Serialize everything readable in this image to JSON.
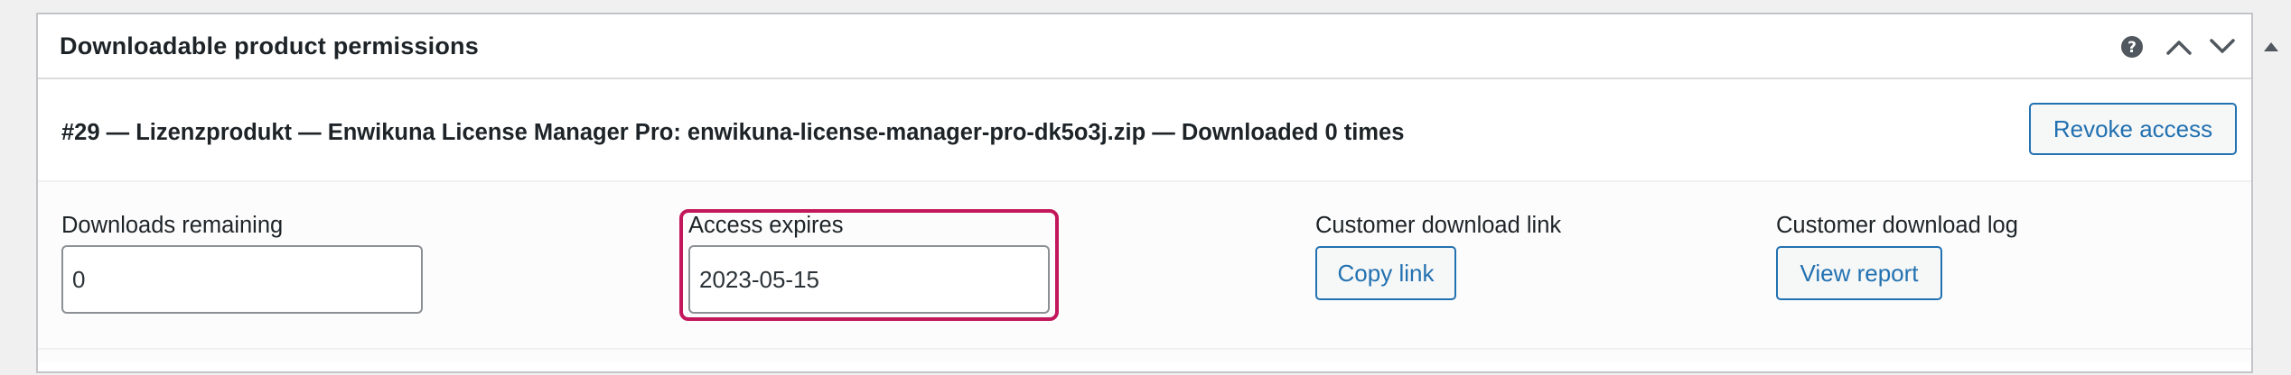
{
  "metabox": {
    "title": "Downloadable product permissions",
    "icons": [
      "help-icon",
      "move-up-icon",
      "move-down-icon",
      "toggle-panel-icon"
    ]
  },
  "permission": {
    "title": "#29 — Lizenzprodukt — Enwikuna License Manager Pro: enwikuna-license-manager-pro-dk5o3j.zip — Downloaded 0 times",
    "revoke_label": "Revoke access",
    "downloads_remaining": {
      "label": "Downloads remaining",
      "value": "0"
    },
    "access_expires": {
      "label": "Access expires",
      "value": "2023-05-15"
    },
    "download_link": {
      "label": "Customer download link",
      "button": "Copy link"
    },
    "download_log": {
      "label": "Customer download log",
      "button": "View report"
    }
  },
  "colors": {
    "accent": "#2271b1",
    "highlight": "#c2185b",
    "text": "#1d2327",
    "border": "#c3c4c7"
  }
}
